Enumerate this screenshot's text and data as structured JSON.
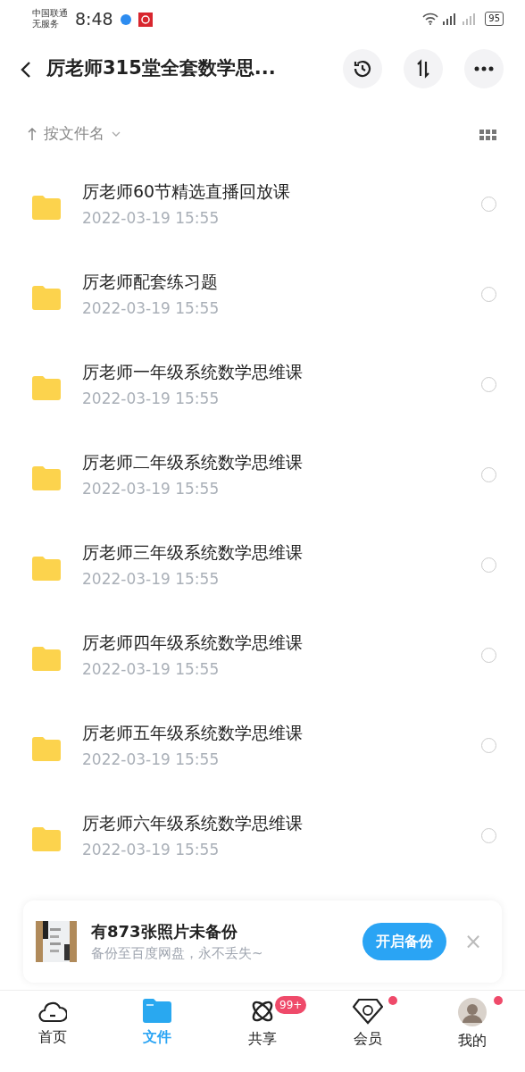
{
  "status_bar": {
    "carrier": "中国联通",
    "service": "无服务",
    "time": "8:48",
    "battery": "95"
  },
  "header": {
    "title": "厉老师315堂全套数学思..."
  },
  "sort": {
    "label": "按文件名"
  },
  "files": [
    {
      "name": "厉老师60节精选直播回放课",
      "date": "2022-03-19  15:55",
      "selected": false
    },
    {
      "name": "厉老师配套练习题",
      "date": "2022-03-19  15:55",
      "selected": false
    },
    {
      "name": "厉老师一年级系统数学思维课",
      "date": "2022-03-19  15:55",
      "selected": false
    },
    {
      "name": "厉老师二年级系统数学思维课",
      "date": "2022-03-19  15:55",
      "selected": false
    },
    {
      "name": "厉老师三年级系统数学思维课",
      "date": "2022-03-19  15:55",
      "selected": false
    },
    {
      "name": "厉老师四年级系统数学思维课",
      "date": "2022-03-19  15:55",
      "selected": false
    },
    {
      "name": "厉老师五年级系统数学思维课",
      "date": "2022-03-19  15:55",
      "selected": false
    },
    {
      "name": "厉老师六年级系统数学思维课",
      "date": "2022-03-19  15:55",
      "selected": false
    }
  ],
  "backup_banner": {
    "title": "有873张照片未备份",
    "subtitle": "备份至百度网盘，永不丢失~",
    "button": "开启备份",
    "close": "×"
  },
  "tab_bar": [
    {
      "kind": "home",
      "label": "首页",
      "selected": false
    },
    {
      "kind": "files",
      "label": "文件",
      "selected": true
    },
    {
      "kind": "share",
      "label": "共享",
      "selected": false,
      "badge": "99+"
    },
    {
      "kind": "vip",
      "label": "会员",
      "selected": false,
      "dot": true
    },
    {
      "kind": "me",
      "label": "我的",
      "selected": false,
      "dot": true
    }
  ]
}
